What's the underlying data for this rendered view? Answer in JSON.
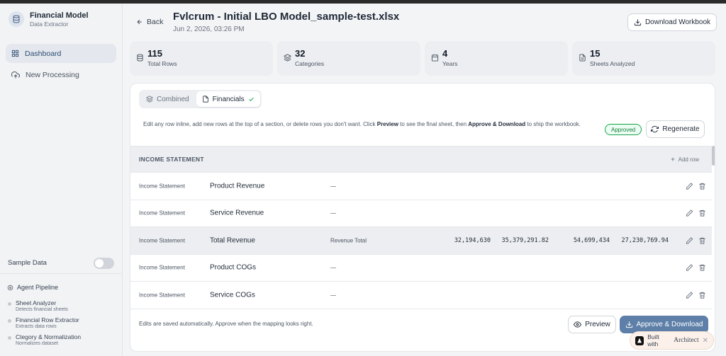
{
  "sidebar": {
    "brand_title": "Financial Model",
    "brand_subtitle": "Data Extractor",
    "nav": [
      {
        "label": "Dashboard",
        "icon": "grid-icon",
        "active": true
      },
      {
        "label": "New Processing",
        "icon": "cloud-upload-icon",
        "active": false
      }
    ],
    "sample_data_label": "Sample Data",
    "sample_data_on": false,
    "pipeline_title": "Agent Pipeline",
    "pipeline": [
      {
        "title": "Sheet Analyzer",
        "subtitle": "Detects financial sheets"
      },
      {
        "title": "Financial Row Extractor",
        "subtitle": "Extracts data rows"
      },
      {
        "title": "Ctegory & Normalization",
        "subtitle": "Normalizes dataset"
      }
    ]
  },
  "header": {
    "back_label": "Back",
    "file_title": "Fvlcrum - Initial LBO Model_sample-test.xlsx",
    "file_date": "Jun 2, 2026, 03:26 PM",
    "download_label": "Download Workbook"
  },
  "stats": [
    {
      "value": "115",
      "label": "Total Rows",
      "icon": "database-icon"
    },
    {
      "value": "32",
      "label": "Categories",
      "icon": "layers-icon"
    },
    {
      "value": "4",
      "label": "Years",
      "icon": "calendar-icon"
    },
    {
      "value": "15",
      "label": "Sheets Analyzed",
      "icon": "file-icon"
    }
  ],
  "tabs": [
    {
      "label": "Combined",
      "icon": "layers-icon",
      "active": false
    },
    {
      "label": "Financials",
      "icon": "file-icon",
      "active": true
    }
  ],
  "instructions": {
    "part1": "Edit any row inline, add new rows at the top of a section, or delete rows you don't want. Click ",
    "preview": "Preview",
    "part2": " to see the final sheet, then ",
    "approve": "Approve & Download",
    "part3": " to ship the workbook."
  },
  "status_badge": "Approved",
  "regenerate_label": "Regenerate",
  "section": {
    "title": "INCOME STATEMENT",
    "add_row_label": "Add row"
  },
  "rows": [
    {
      "section": "Income Statement",
      "name": "Product Revenue",
      "mapping": "—",
      "values": [
        "",
        "",
        "",
        ""
      ],
      "highlighted": false
    },
    {
      "section": "Income Statement",
      "name": "Service Revenue",
      "mapping": "—",
      "values": [
        "",
        "",
        "",
        ""
      ],
      "highlighted": false
    },
    {
      "section": "Income Statement",
      "name": "Total Revenue",
      "mapping": "Revenue Total",
      "values": [
        "32,194,630",
        "35,379,291.82",
        "54,699,434",
        "27,230,769.94"
      ],
      "highlighted": true
    },
    {
      "section": "Income Statement",
      "name": "Product COGs",
      "mapping": "—",
      "values": [
        "",
        "",
        "",
        ""
      ],
      "highlighted": false
    },
    {
      "section": "Income Statement",
      "name": "Service COGs",
      "mapping": "—",
      "values": [
        "",
        "",
        "",
        ""
      ],
      "highlighted": false
    }
  ],
  "footer": {
    "note": "Edits are saved automatically. Approve when the mapping looks right.",
    "preview_label": "Preview",
    "approve_label": "Approve & Download"
  },
  "badge": {
    "prefix": "Built with",
    "brand": "Architect"
  },
  "colors": {
    "accent": "#5d7fa8",
    "approved": "#16a34a",
    "sidebar_active": "#e4e8ee"
  }
}
